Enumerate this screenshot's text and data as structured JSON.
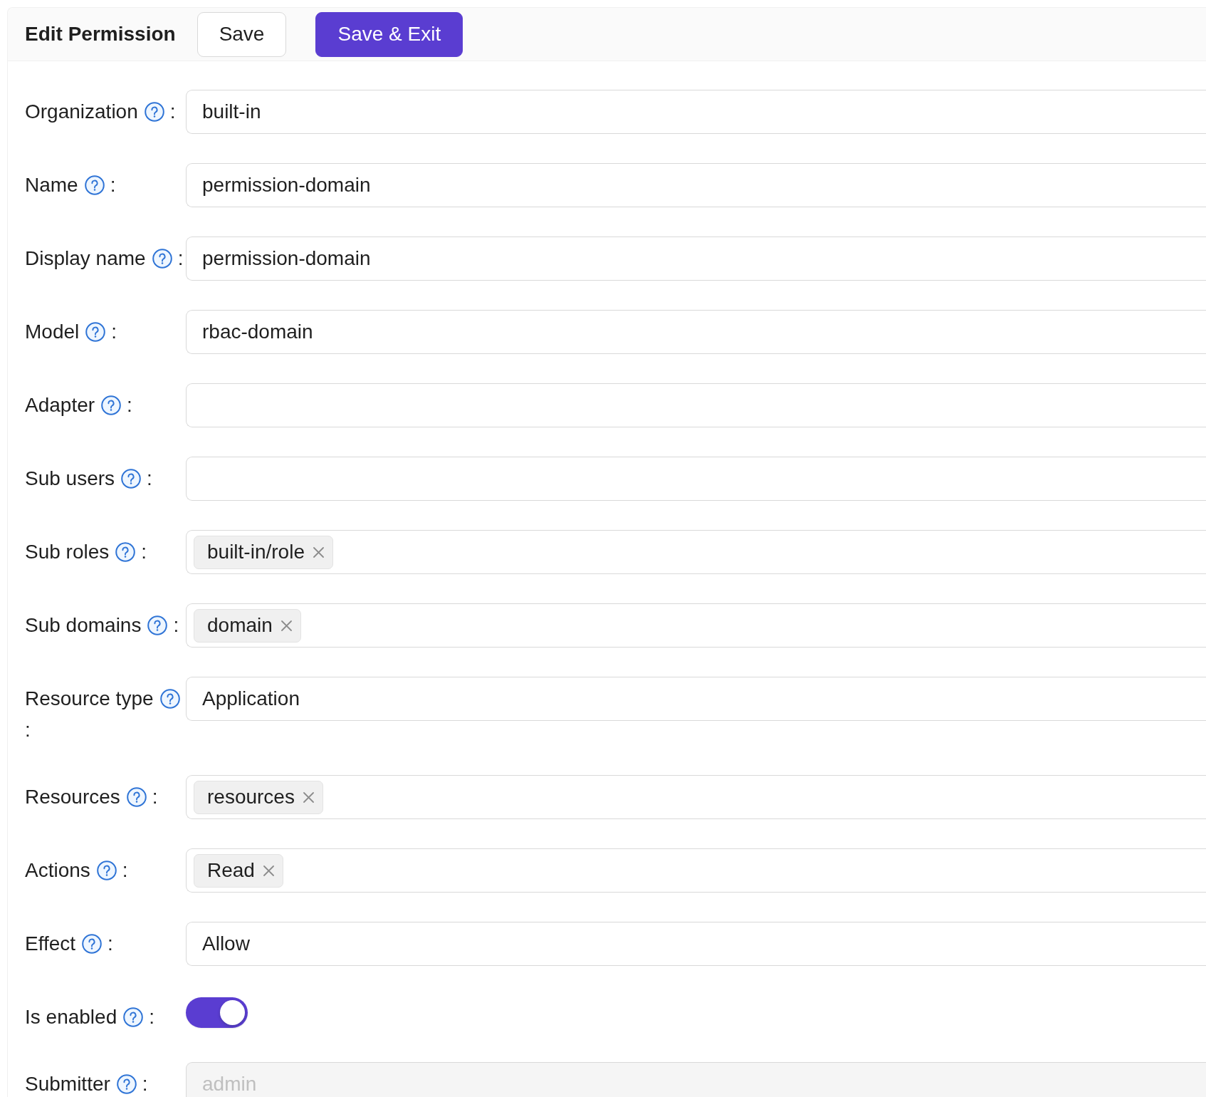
{
  "header": {
    "title": "Edit Permission",
    "buttons": [
      {
        "label": "Save",
        "kind": "default"
      },
      {
        "label": "Save & Exit",
        "kind": "primary"
      }
    ]
  },
  "form": {
    "fields": [
      {
        "label": "Organization",
        "colon": ":",
        "kind": "text",
        "value": "built-in",
        "disabled": false
      },
      {
        "label": "Name",
        "colon": ":",
        "kind": "text",
        "value": "permission-domain",
        "disabled": false
      },
      {
        "label": "Display name",
        "colon": ":",
        "kind": "text",
        "value": "permission-domain",
        "disabled": false
      },
      {
        "label": "Model",
        "colon": ":",
        "kind": "text",
        "value": "rbac-domain",
        "disabled": false
      },
      {
        "label": "Adapter",
        "colon": ":",
        "kind": "text"
      },
      {
        "label": "Sub users",
        "colon": ":",
        "kind": "tags"
      },
      {
        "label": "Sub roles",
        "colon": ":",
        "kind": "tags",
        "tags": [
          "built-in/role"
        ],
        "disabled": false
      },
      {
        "label": "Sub domains",
        "colon": ":",
        "kind": "tags",
        "tags": [
          "domain"
        ],
        "disabled": false
      },
      {
        "label": "Resource type",
        "colon": ":",
        "kind": "text",
        "value": "Application",
        "disabled": false
      },
      {
        "label": "Resources",
        "colon": ":",
        "kind": "tags",
        "tags": [
          "resources"
        ],
        "disabled": false
      },
      {
        "label": "Actions",
        "colon": ":",
        "kind": "tags",
        "tags": [
          "Read"
        ],
        "disabled": false
      },
      {
        "label": "Effect",
        "colon": ":",
        "kind": "text",
        "value": "Allow",
        "disabled": false
      },
      {
        "label": "Is enabled",
        "colon": ":",
        "kind": "switch",
        "on": true,
        "disabled": false
      },
      {
        "label": "Submitter",
        "colon": ":",
        "kind": "text",
        "value": "admin",
        "disabled": true
      }
    ]
  }
}
